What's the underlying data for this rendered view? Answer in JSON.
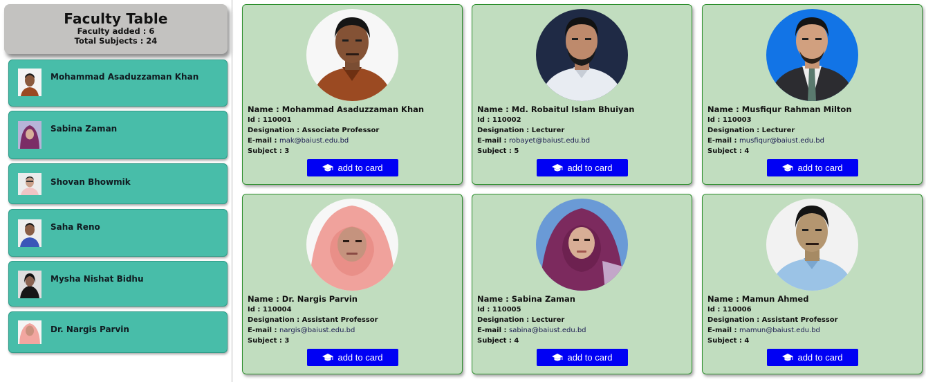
{
  "summary": {
    "title": "Faculty Table",
    "faculty_added": "Faculty added : 6",
    "total_subjects": "Total Subjects : 24"
  },
  "sidebar": {
    "items": [
      {
        "name": "Mohammad Asaduzzaman Khan"
      },
      {
        "name": "Sabina Zaman"
      },
      {
        "name": "Shovan Bhowmik"
      },
      {
        "name": "Saha Reno"
      },
      {
        "name": "Mysha Nishat Bidhu"
      },
      {
        "name": "Dr. Nargis Parvin"
      }
    ]
  },
  "cards": [
    {
      "name": "Name : Mohammad Asaduzzaman Khan",
      "id": "Id : 110001",
      "designation_label": "Designation :",
      "designation": "Associate Professor",
      "email_label": "E-mail :",
      "email": "mak@baiust.edu.bd",
      "subject": "Subject : 3",
      "button": "add to card"
    },
    {
      "name": "Name : Md. Robaitul Islam Bhuiyan",
      "id": "Id : 110002",
      "designation_label": "Designation :",
      "designation": "Lecturer",
      "email_label": "E-mail :",
      "email": "robayet@baiust.edu.bd",
      "subject": "Subject : 5",
      "button": "add to card"
    },
    {
      "name": "Name : Musfiqur Rahman Milton",
      "id": "Id : 110003",
      "designation_label": "Designation :",
      "designation": "Lecturer",
      "email_label": "E-mail :",
      "email": "musfiqur@baiust.edu.bd",
      "subject": "Subject : 4",
      "button": "add to card"
    },
    {
      "name": "Name : Dr. Nargis Parvin",
      "id": "Id : 110004",
      "designation_label": "Designation :",
      "designation": "Assistant Professor",
      "email_label": "E-mail :",
      "email": "nargis@baiust.edu.bd",
      "subject": "Subject : 3",
      "button": "add to card"
    },
    {
      "name": "Name : Sabina Zaman",
      "id": "Id : 110005",
      "designation_label": "Designation :",
      "designation": "Lecturer",
      "email_label": "E-mail :",
      "email": "sabina@baiust.edu.bd",
      "subject": "Subject : 4",
      "button": "add to card"
    },
    {
      "name": "Name : Mamun Ahmed",
      "id": "Id : 110006",
      "designation_label": "Designation :",
      "designation": "Assistant Professor",
      "email_label": "E-mail :",
      "email": "mamun@baiust.edu.bd",
      "subject": "Subject : 4",
      "button": "add to card"
    }
  ],
  "icons": {
    "button_icon": "graduation-cap-icon"
  },
  "colors": {
    "sidebar_item": "#48bda9",
    "summary_box": "#c3c2c0",
    "card_bg": "#c1ddbf",
    "card_border": "#2d8f2d",
    "button": "#0000f4"
  }
}
